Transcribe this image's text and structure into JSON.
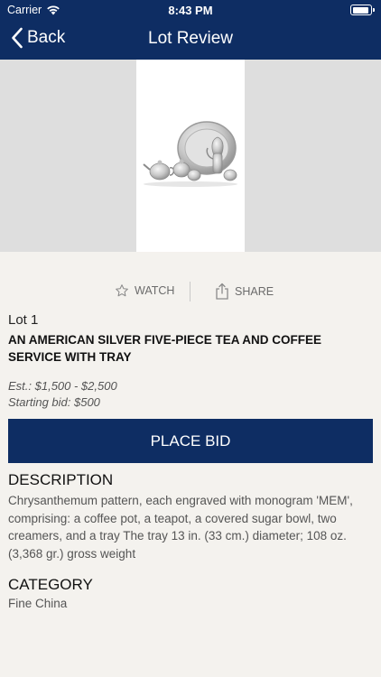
{
  "status_bar": {
    "carrier": "Carrier",
    "time": "8:43 PM"
  },
  "nav": {
    "back_label": "Back",
    "title": "Lot Review"
  },
  "actions": {
    "watch_label": "WATCH",
    "share_label": "SHARE"
  },
  "lot": {
    "number": "Lot 1",
    "title": "AN AMERICAN SILVER FIVE-PIECE TEA AND COFFEE SERVICE WITH TRAY",
    "estimate": "Est.: $1,500 - $2,500",
    "starting_bid": "Starting bid: $500"
  },
  "place_bid_label": "PLACE BID",
  "description": {
    "heading": "DESCRIPTION",
    "text": "Chrysanthemum pattern, each engraved with monogram 'MEM', comprising: a coffee pot, a teapot, a covered sugar bowl, two creamers, and a tray The tray 13 in. (33 cm.) diameter; 108 oz. (3,368 gr.) gross weight"
  },
  "category": {
    "heading": "CATEGORY",
    "text": "Fine China"
  },
  "colors": {
    "navy": "#0e2d63",
    "background": "#f4f2ee",
    "image_backdrop": "#dedede"
  }
}
